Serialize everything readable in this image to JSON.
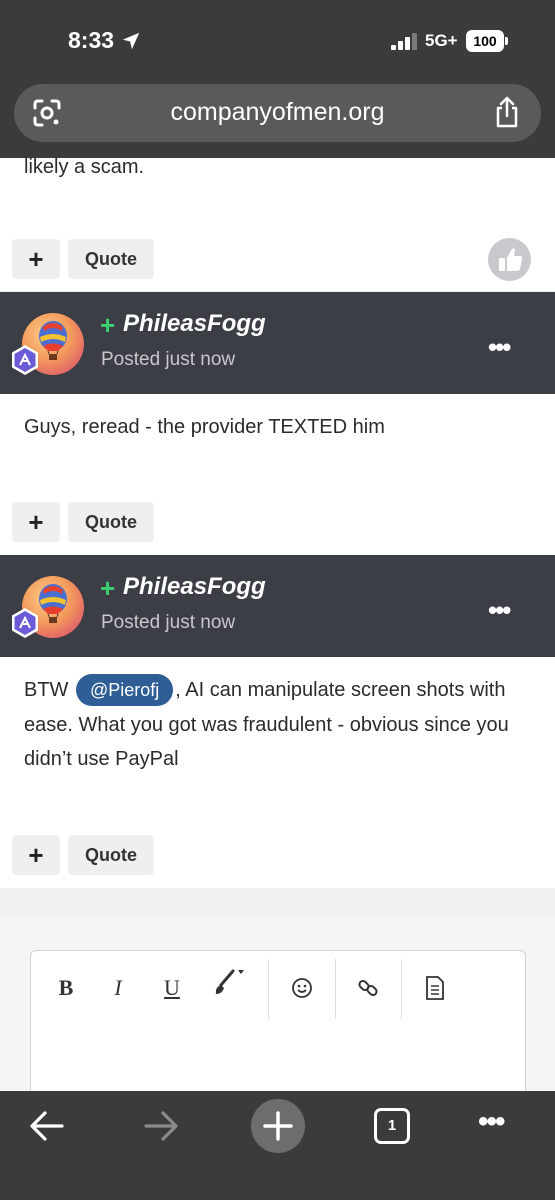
{
  "status_bar": {
    "time": "8:33",
    "network": "5G+",
    "battery": "100"
  },
  "browser": {
    "url": "companyofmen.org",
    "tab_count": "1"
  },
  "partial_post": {
    "text_fragment": "likely a scam.",
    "quote_label": "Quote",
    "plus_label": "+"
  },
  "posts": [
    {
      "author_prefix": "+",
      "author": "PhileasFogg",
      "posted": "Posted just now",
      "body": "Guys, reread - the provider TEXTED him",
      "plus_label": "+",
      "quote_label": "Quote",
      "more_label": "•••"
    },
    {
      "author_prefix": "+",
      "author": "PhileasFogg",
      "posted": "Posted just now",
      "body_before": "BTW ",
      "mention": "@Pierofj",
      "body_after": ", AI can manipulate screen shots with ease.   What you got was fraudulent - obvious since you didn’t use PayPal",
      "plus_label": "+",
      "quote_label": "Quote",
      "more_label": "•••"
    }
  ],
  "editor_toolbar": {
    "bold": "B",
    "italic": "I",
    "underline": "U"
  },
  "colors": {
    "chrome_bg": "#3b3b3d",
    "post_header_bg": "#3b3e45",
    "mention_bg": "#2f5d96",
    "plus_green": "#3bd16f"
  }
}
